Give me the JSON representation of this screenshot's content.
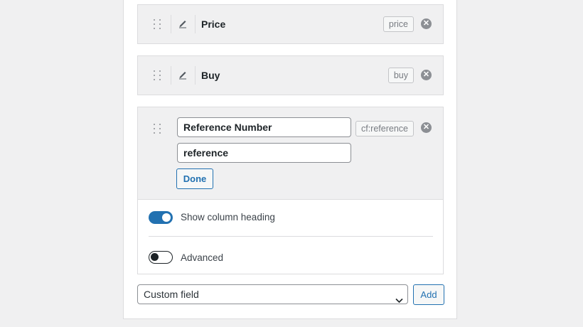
{
  "columns": [
    {
      "label": "Price",
      "slug": "price"
    },
    {
      "label": "Buy",
      "slug": "buy"
    }
  ],
  "editing": {
    "label_value": "Reference Number",
    "name_value": "reference",
    "slug": "cf:reference",
    "done_label": "Done",
    "show_heading_label": "Show column heading",
    "show_heading_on": true,
    "advanced_label": "Advanced",
    "advanced_on": false
  },
  "footer": {
    "select_value": "Custom field",
    "add_label": "Add"
  },
  "icons": {
    "drag": "drag-handle-icon",
    "edit": "pencil-icon",
    "remove": "remove-icon",
    "dropdown": "chevron-down-icon"
  },
  "colors": {
    "accent": "#2271b1",
    "remove_icon": "#8c8f94"
  }
}
